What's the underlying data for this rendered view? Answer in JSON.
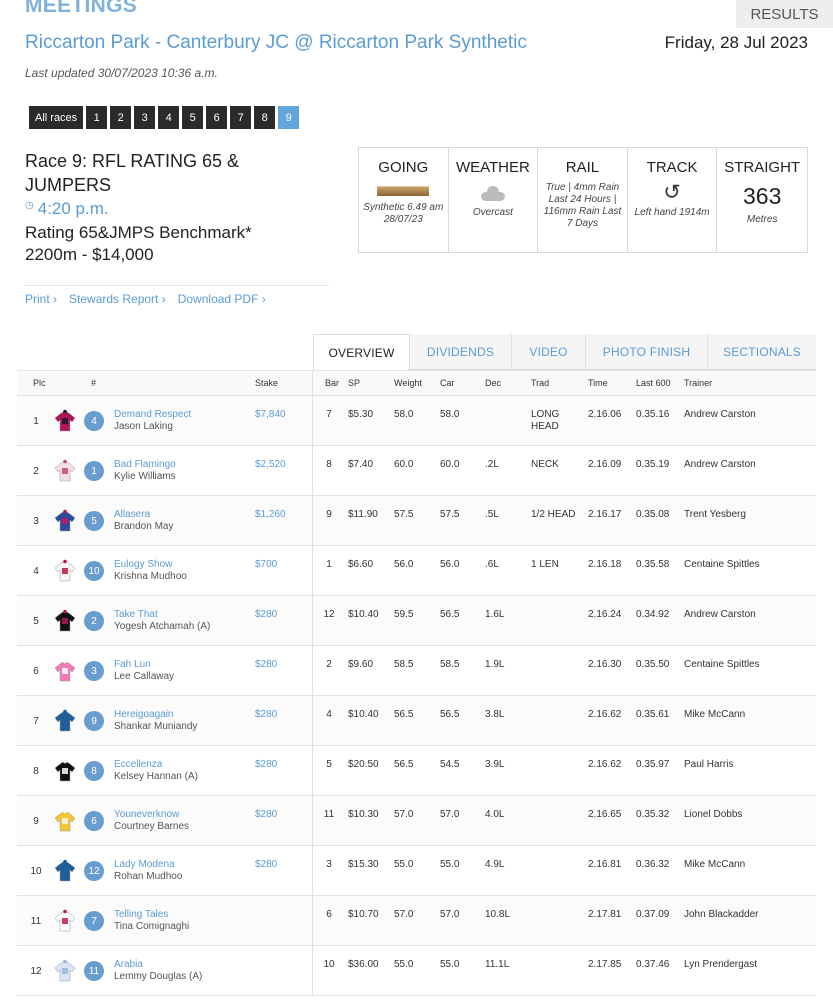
{
  "header": {
    "heading": "MEETINGS",
    "results_tab": "RESULTS",
    "meeting_title": "Riccarton Park - Canterbury JC @ Riccarton Park Synthetic",
    "date": "Friday, 28 Jul 2023",
    "last_updated": "Last updated 30/07/2023 10:36 a.m."
  },
  "race_tabs": [
    "All races",
    "1",
    "2",
    "3",
    "4",
    "5",
    "6",
    "7",
    "8",
    "9"
  ],
  "active_race_tab": "9",
  "race": {
    "title": "Race 9: RFL RATING 65 & JUMPERS",
    "time": "4:20 p.m.",
    "class": "Rating 65&JMPS Benchmark*",
    "distance_prize": "2200m - $14,000"
  },
  "links": {
    "print": "Print ›",
    "stewards": "Stewards Report ›",
    "pdf": "Download PDF ›"
  },
  "conditions": {
    "going": {
      "label": "GOING",
      "value": "Synthetic 6.49 am 28/07/23"
    },
    "weather": {
      "label": "WEATHER",
      "value": "Overcast"
    },
    "rail": {
      "label": "RAIL",
      "value": "True | 4mm Rain Last 24 Hours | 116mm Rain Last 7 Days"
    },
    "track": {
      "label": "TRACK",
      "value": "Left hand 1914m"
    },
    "straight": {
      "label": "STRAIGHT",
      "number": "363",
      "unit": "Metres"
    }
  },
  "tabs": {
    "overview": "OVERVIEW",
    "dividends": "DIVIDENDS",
    "video": "VIDEO",
    "photo_finish": "PHOTO FINISH",
    "sectionals": "SECTIONALS"
  },
  "columns": {
    "plc": "Plc",
    "num": "#",
    "stake": "Stake",
    "bar": "Bar",
    "sp": "SP",
    "weight": "Weight",
    "car": "Car",
    "dec": "Dec",
    "trad": "Trad",
    "time": "Time",
    "last600": "Last 600",
    "trainer": "Trainer"
  },
  "icons": {
    "clock": "clock-icon",
    "going": "synthetic-track-icon",
    "weather": "cloud-icon",
    "track": "left-hand-loop-icon"
  },
  "colors": {
    "accent": "#5b9bd5",
    "active_tab": "#63a6dc",
    "badge": "#6a9dcf",
    "dark_tab": "#2b2b2b"
  },
  "runners": [
    {
      "plc": "1",
      "num": "4",
      "horse": "Demand Respect",
      "jockey": "Jason Laking",
      "stake": "$7,840",
      "bar": "7",
      "sp": "$5.30",
      "weight": "58.0",
      "car": "58.0",
      "dec": "",
      "trad": "LONG HEAD",
      "time": "2.16.06",
      "last600": "0.35.16",
      "trainer": "Andrew Carston",
      "silk": [
        "#b0145a",
        "#1a1a2e"
      ]
    },
    {
      "plc": "2",
      "num": "1",
      "horse": "Bad Flamingo",
      "jockey": "Kylie Williams",
      "stake": "$2,520",
      "bar": "8",
      "sp": "$7.40",
      "weight": "60.0",
      "car": "60.0",
      "dec": ".2L",
      "trad": "NECK",
      "time": "2.16.09",
      "last600": "0.35.19",
      "trainer": "Andrew Carston",
      "silk": [
        "#f4e0e4",
        "#c8456a"
      ]
    },
    {
      "plc": "3",
      "num": "5",
      "horse": "Allasera",
      "jockey": "Brandon May",
      "stake": "$1,260",
      "bar": "9",
      "sp": "$11.90",
      "weight": "57.5",
      "car": "57.5",
      "dec": ".5L",
      "trad": "1/2 HEAD",
      "time": "2.16.17",
      "last600": "0.35.08",
      "trainer": "Trent Yesberg",
      "silk": [
        "#2c4a9a",
        "#c2185b"
      ]
    },
    {
      "plc": "4",
      "num": "10",
      "horse": "Eulogy Show",
      "jockey": "Krishna Mudhoo",
      "stake": "$700",
      "bar": "1",
      "sp": "$6.60",
      "weight": "56.0",
      "car": "56.0",
      "dec": ".6L",
      "trad": "1 LEN",
      "time": "2.16.18",
      "last600": "0.35.58",
      "trainer": "Centaine Spittles",
      "silk": [
        "#f6f6f6",
        "#c0183a"
      ]
    },
    {
      "plc": "5",
      "num": "2",
      "horse": "Take That",
      "jockey": "Yogesh Atchamah (A)",
      "stake": "$280",
      "bar": "12",
      "sp": "$10.40",
      "weight": "59.5",
      "car": "56.5",
      "dec": "1.6L",
      "trad": "",
      "time": "2.16.24",
      "last600": "0.34.92",
      "trainer": "Andrew Carston",
      "silk": [
        "#111111",
        "#b0145a"
      ]
    },
    {
      "plc": "6",
      "num": "3",
      "horse": "Fah Lun",
      "jockey": "Lee Callaway",
      "stake": "$280",
      "bar": "2",
      "sp": "$9.60",
      "weight": "58.5",
      "car": "58.5",
      "dec": "1.9L",
      "trad": "",
      "time": "2.16.30",
      "last600": "0.35.50",
      "trainer": "Centaine Spittles",
      "silk": [
        "#f07ab8",
        "#ffffff"
      ]
    },
    {
      "plc": "7",
      "num": "9",
      "horse": "Hereigoagain",
      "jockey": "Shankar Muniandy",
      "stake": "$280",
      "bar": "4",
      "sp": "$10.40",
      "weight": "56.5",
      "car": "56.5",
      "dec": "3.8L",
      "trad": "",
      "time": "2.16.62",
      "last600": "0.35.61",
      "trainer": "Mike McCann",
      "silk": [
        "#1f5f99",
        "#1f5f99"
      ]
    },
    {
      "plc": "8",
      "num": "8",
      "horse": "Eccellenza",
      "jockey": "Kelsey Hannan (A)",
      "stake": "$280",
      "bar": "5",
      "sp": "$20.50",
      "weight": "56.5",
      "car": "54.5",
      "dec": "3.9L",
      "trad": "",
      "time": "2.16.62",
      "last600": "0.35.97",
      "trainer": "Paul Harris",
      "silk": [
        "#111111",
        "#ffffff"
      ]
    },
    {
      "plc": "9",
      "num": "6",
      "horse": "Youneverknow",
      "jockey": "Courtney Barnes",
      "stake": "$280",
      "bar": "11",
      "sp": "$10.30",
      "weight": "57.0",
      "car": "57.0",
      "dec": "4.0L",
      "trad": "",
      "time": "2.16.65",
      "last600": "0.35.32",
      "trainer": "Lionel Dobbs",
      "silk": [
        "#f2c531",
        "#f6f6f6"
      ]
    },
    {
      "plc": "10",
      "num": "12",
      "horse": "Lady Modena",
      "jockey": "Rohan Mudhoo",
      "stake": "$280",
      "bar": "3",
      "sp": "$15.30",
      "weight": "55.0",
      "car": "55.0",
      "dec": "4.9L",
      "trad": "",
      "time": "2.16.81",
      "last600": "0.36.32",
      "trainer": "Mike McCann",
      "silk": [
        "#1f5f99",
        "#1f5f99"
      ]
    },
    {
      "plc": "11",
      "num": "7",
      "horse": "Telling Tales",
      "jockey": "Tina Comignaghi",
      "stake": "",
      "bar": "6",
      "sp": "$10.70",
      "weight": "57.0",
      "car": "57.0",
      "dec": "10.8L",
      "trad": "",
      "time": "2.17.81",
      "last600": "0.37.09",
      "trainer": "John Blackadder",
      "silk": [
        "#ffffff",
        "#c2185b"
      ]
    },
    {
      "plc": "12",
      "num": "11",
      "horse": "Arabia",
      "jockey": "Lemmy Douglas (A)",
      "stake": "",
      "bar": "10",
      "sp": "$36.00",
      "weight": "55.0",
      "car": "55.0",
      "dec": "11.1L",
      "trad": "",
      "time": "2.17.85",
      "last600": "0.37.46",
      "trainer": "Lyn Prendergast",
      "silk": [
        "#d8e6f5",
        "#9ab6d6"
      ]
    }
  ]
}
